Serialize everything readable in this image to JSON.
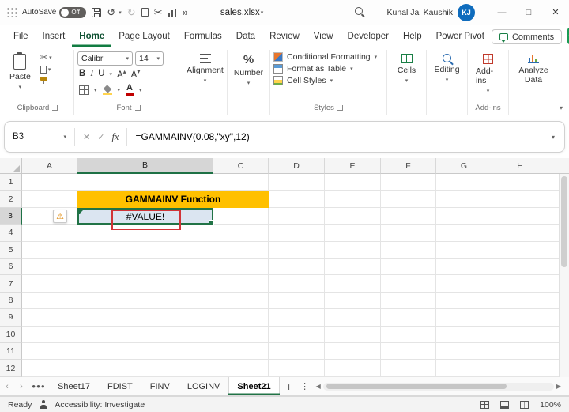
{
  "titlebar": {
    "autosave_label": "AutoSave",
    "autosave_state": "Off",
    "filename": "sales.xlsx",
    "user_name": "Kunal Jai Kaushik",
    "user_initials": "KJ"
  },
  "ribbon_tabs": [
    "File",
    "Insert",
    "Home",
    "Page Layout",
    "Formulas",
    "Data",
    "Review",
    "View",
    "Developer",
    "Help",
    "Power Pivot"
  ],
  "comments_label": "Comments",
  "ribbon": {
    "paste_label": "Paste",
    "clipboard_label": "Clipboard",
    "font_name": "Calibri",
    "font_size": "14",
    "bold": "B",
    "italic": "I",
    "underline": "U",
    "font_label": "Font",
    "alignment_label": "Alignment",
    "number_label": "Number",
    "styles": [
      "Conditional Formatting",
      "Format as Table",
      "Cell Styles"
    ],
    "styles_label": "Styles",
    "cells_label": "Cells",
    "editing_label": "Editing",
    "addins_label": "Add-ins",
    "addins_group_label": "Add-ins",
    "analyze_label": "Analyze Data"
  },
  "formula_bar": {
    "name_box": "B3",
    "fx": "fx",
    "formula": "=GAMMAINV(0.08,\"xy\",12)"
  },
  "grid": {
    "columns": [
      "A",
      "B",
      "C",
      "D",
      "E",
      "F",
      "G",
      "H"
    ],
    "rows": [
      "1",
      "2",
      "3",
      "4",
      "5",
      "6",
      "7",
      "8",
      "9",
      "10",
      "11",
      "12"
    ],
    "banner_text": "GAMMAINV Function",
    "error_value": "#VALUE!"
  },
  "sheet_tabs": [
    "Sheet17",
    "FDIST",
    "FINV",
    "LOGINV",
    "Sheet21"
  ],
  "status": {
    "ready": "Ready",
    "accessibility": "Accessibility: Investigate",
    "zoom": "100%"
  }
}
